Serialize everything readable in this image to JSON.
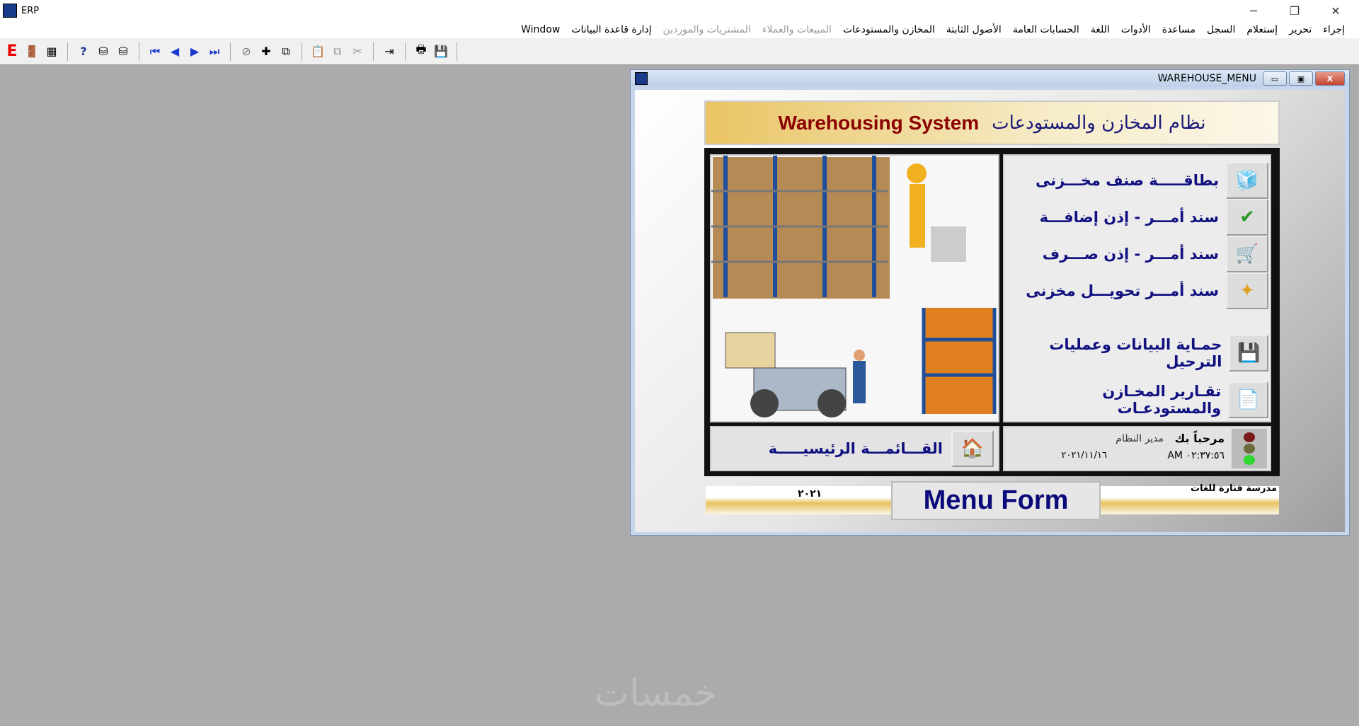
{
  "app": {
    "title": "ERP",
    "minimize": "─",
    "restore": "❐",
    "close": "✕"
  },
  "menubar": [
    {
      "label": "إجراء",
      "enabled": true
    },
    {
      "label": "تحرير",
      "enabled": true
    },
    {
      "label": "إستعلام",
      "enabled": true
    },
    {
      "label": "السجل",
      "enabled": true
    },
    {
      "label": "مساعدة",
      "enabled": true
    },
    {
      "label": "الأدوات",
      "enabled": true
    },
    {
      "label": "اللغة",
      "enabled": true
    },
    {
      "label": "الحسابات العامة",
      "enabled": true
    },
    {
      "label": "الأصول الثابتة",
      "enabled": true
    },
    {
      "label": "المخازن والمستودعات",
      "enabled": true
    },
    {
      "label": "المبيعات والعملاء",
      "enabled": false
    },
    {
      "label": "المشتريات والموردين",
      "enabled": false
    },
    {
      "label": "إدارة قاعدة البيانات",
      "enabled": true
    },
    {
      "label": "Window",
      "enabled": true
    }
  ],
  "toolbar": {
    "exit": "E",
    "help": "?"
  },
  "child": {
    "title": "WAREHOUSE_MENU",
    "min": "▭",
    "max": "▣",
    "close": "X",
    "banner_en": "Warehousing System",
    "banner_ar": "نظام المخازن والمستودعات",
    "items": [
      {
        "label": "بطاقـــــة صنف مخـــزنى",
        "icon": "cubes-icon"
      },
      {
        "label": "سند أمـــر - إذن إضافـــة",
        "icon": "checkmark-icon"
      },
      {
        "label": "سند أمـــر - إذن صـــرف",
        "icon": "cart-icon"
      },
      {
        "label": "سند أمـــر تحويـــل مخزنى",
        "icon": "transfer-icon"
      },
      {
        "label": "حمـاية البيانات وعمليات الترحيل",
        "icon": "save-icon"
      },
      {
        "label": "تقـارير المخـازن والمستودعـات",
        "icon": "report-icon"
      }
    ],
    "main_menu": "القـــائمـــة الرئيسيـــــة",
    "welcome": "مرحباً بك",
    "user": "مدير النظام",
    "time": "AM ٠٢:٣٧:٥٦",
    "date": "٢٠٢١/١١/١٦",
    "year": "٢٠٢١",
    "school": "مدرسة فنارة للغات",
    "form_name": "Menu Form"
  },
  "watermark": "خمسات"
}
